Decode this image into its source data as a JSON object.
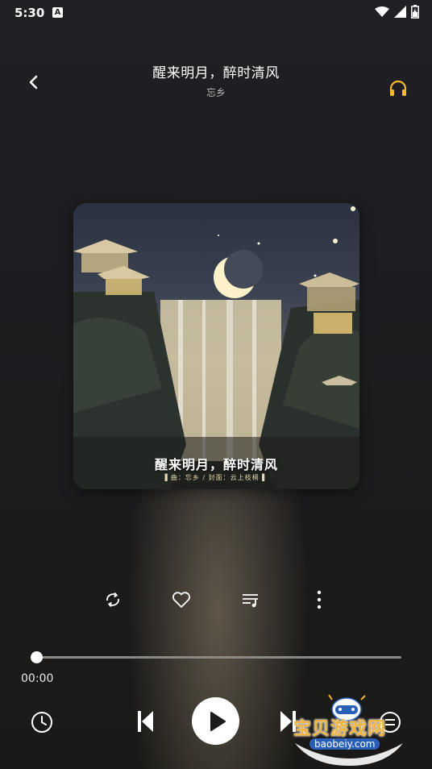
{
  "status_bar": {
    "time": "5:30",
    "notification_glyph": "A",
    "icons": [
      "wifi-icon",
      "signal-icon",
      "battery-icon"
    ]
  },
  "header": {
    "title": "醒来明月，醉时清风",
    "artist": "忘乡",
    "back_icon": "chevron-left-icon",
    "right_icon": "headphones-icon"
  },
  "cover": {
    "title": "醒来明月，醉时清风",
    "credit": "▌曲：忘乡 / 封面：云上枝桐 ▌"
  },
  "actions": [
    "repeat-icon",
    "heart-icon",
    "playlist-icon",
    "more-vertical-icon"
  ],
  "player": {
    "current_time": "00:00",
    "progress": 0
  },
  "controls": [
    "clock-icon",
    "previous-icon",
    "play-icon",
    "next-icon",
    "queue-icon"
  ],
  "watermark": {
    "text": "宝贝游戏网",
    "url": "baobeiy.com"
  },
  "colors": {
    "accent_headphones": "#f5b932",
    "watermark": "#f0b43a"
  }
}
